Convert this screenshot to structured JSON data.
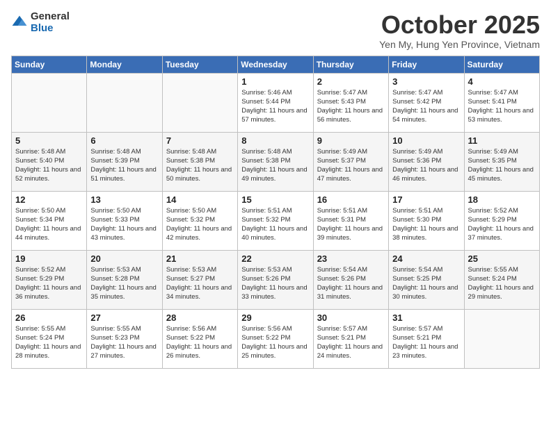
{
  "logo": {
    "general": "General",
    "blue": "Blue"
  },
  "title": "October 2025",
  "location": "Yen My, Hung Yen Province, Vietnam",
  "days_header": [
    "Sunday",
    "Monday",
    "Tuesday",
    "Wednesday",
    "Thursday",
    "Friday",
    "Saturday"
  ],
  "weeks": [
    [
      {
        "day": "",
        "info": ""
      },
      {
        "day": "",
        "info": ""
      },
      {
        "day": "",
        "info": ""
      },
      {
        "day": "1",
        "info": "Sunrise: 5:46 AM\nSunset: 5:44 PM\nDaylight: 11 hours and 57 minutes."
      },
      {
        "day": "2",
        "info": "Sunrise: 5:47 AM\nSunset: 5:43 PM\nDaylight: 11 hours and 56 minutes."
      },
      {
        "day": "3",
        "info": "Sunrise: 5:47 AM\nSunset: 5:42 PM\nDaylight: 11 hours and 54 minutes."
      },
      {
        "day": "4",
        "info": "Sunrise: 5:47 AM\nSunset: 5:41 PM\nDaylight: 11 hours and 53 minutes."
      }
    ],
    [
      {
        "day": "5",
        "info": "Sunrise: 5:48 AM\nSunset: 5:40 PM\nDaylight: 11 hours and 52 minutes."
      },
      {
        "day": "6",
        "info": "Sunrise: 5:48 AM\nSunset: 5:39 PM\nDaylight: 11 hours and 51 minutes."
      },
      {
        "day": "7",
        "info": "Sunrise: 5:48 AM\nSunset: 5:38 PM\nDaylight: 11 hours and 50 minutes."
      },
      {
        "day": "8",
        "info": "Sunrise: 5:48 AM\nSunset: 5:38 PM\nDaylight: 11 hours and 49 minutes."
      },
      {
        "day": "9",
        "info": "Sunrise: 5:49 AM\nSunset: 5:37 PM\nDaylight: 11 hours and 47 minutes."
      },
      {
        "day": "10",
        "info": "Sunrise: 5:49 AM\nSunset: 5:36 PM\nDaylight: 11 hours and 46 minutes."
      },
      {
        "day": "11",
        "info": "Sunrise: 5:49 AM\nSunset: 5:35 PM\nDaylight: 11 hours and 45 minutes."
      }
    ],
    [
      {
        "day": "12",
        "info": "Sunrise: 5:50 AM\nSunset: 5:34 PM\nDaylight: 11 hours and 44 minutes."
      },
      {
        "day": "13",
        "info": "Sunrise: 5:50 AM\nSunset: 5:33 PM\nDaylight: 11 hours and 43 minutes."
      },
      {
        "day": "14",
        "info": "Sunrise: 5:50 AM\nSunset: 5:32 PM\nDaylight: 11 hours and 42 minutes."
      },
      {
        "day": "15",
        "info": "Sunrise: 5:51 AM\nSunset: 5:32 PM\nDaylight: 11 hours and 40 minutes."
      },
      {
        "day": "16",
        "info": "Sunrise: 5:51 AM\nSunset: 5:31 PM\nDaylight: 11 hours and 39 minutes."
      },
      {
        "day": "17",
        "info": "Sunrise: 5:51 AM\nSunset: 5:30 PM\nDaylight: 11 hours and 38 minutes."
      },
      {
        "day": "18",
        "info": "Sunrise: 5:52 AM\nSunset: 5:29 PM\nDaylight: 11 hours and 37 minutes."
      }
    ],
    [
      {
        "day": "19",
        "info": "Sunrise: 5:52 AM\nSunset: 5:29 PM\nDaylight: 11 hours and 36 minutes."
      },
      {
        "day": "20",
        "info": "Sunrise: 5:53 AM\nSunset: 5:28 PM\nDaylight: 11 hours and 35 minutes."
      },
      {
        "day": "21",
        "info": "Sunrise: 5:53 AM\nSunset: 5:27 PM\nDaylight: 11 hours and 34 minutes."
      },
      {
        "day": "22",
        "info": "Sunrise: 5:53 AM\nSunset: 5:26 PM\nDaylight: 11 hours and 33 minutes."
      },
      {
        "day": "23",
        "info": "Sunrise: 5:54 AM\nSunset: 5:26 PM\nDaylight: 11 hours and 31 minutes."
      },
      {
        "day": "24",
        "info": "Sunrise: 5:54 AM\nSunset: 5:25 PM\nDaylight: 11 hours and 30 minutes."
      },
      {
        "day": "25",
        "info": "Sunrise: 5:55 AM\nSunset: 5:24 PM\nDaylight: 11 hours and 29 minutes."
      }
    ],
    [
      {
        "day": "26",
        "info": "Sunrise: 5:55 AM\nSunset: 5:24 PM\nDaylight: 11 hours and 28 minutes."
      },
      {
        "day": "27",
        "info": "Sunrise: 5:55 AM\nSunset: 5:23 PM\nDaylight: 11 hours and 27 minutes."
      },
      {
        "day": "28",
        "info": "Sunrise: 5:56 AM\nSunset: 5:22 PM\nDaylight: 11 hours and 26 minutes."
      },
      {
        "day": "29",
        "info": "Sunrise: 5:56 AM\nSunset: 5:22 PM\nDaylight: 11 hours and 25 minutes."
      },
      {
        "day": "30",
        "info": "Sunrise: 5:57 AM\nSunset: 5:21 PM\nDaylight: 11 hours and 24 minutes."
      },
      {
        "day": "31",
        "info": "Sunrise: 5:57 AM\nSunset: 5:21 PM\nDaylight: 11 hours and 23 minutes."
      },
      {
        "day": "",
        "info": ""
      }
    ]
  ]
}
